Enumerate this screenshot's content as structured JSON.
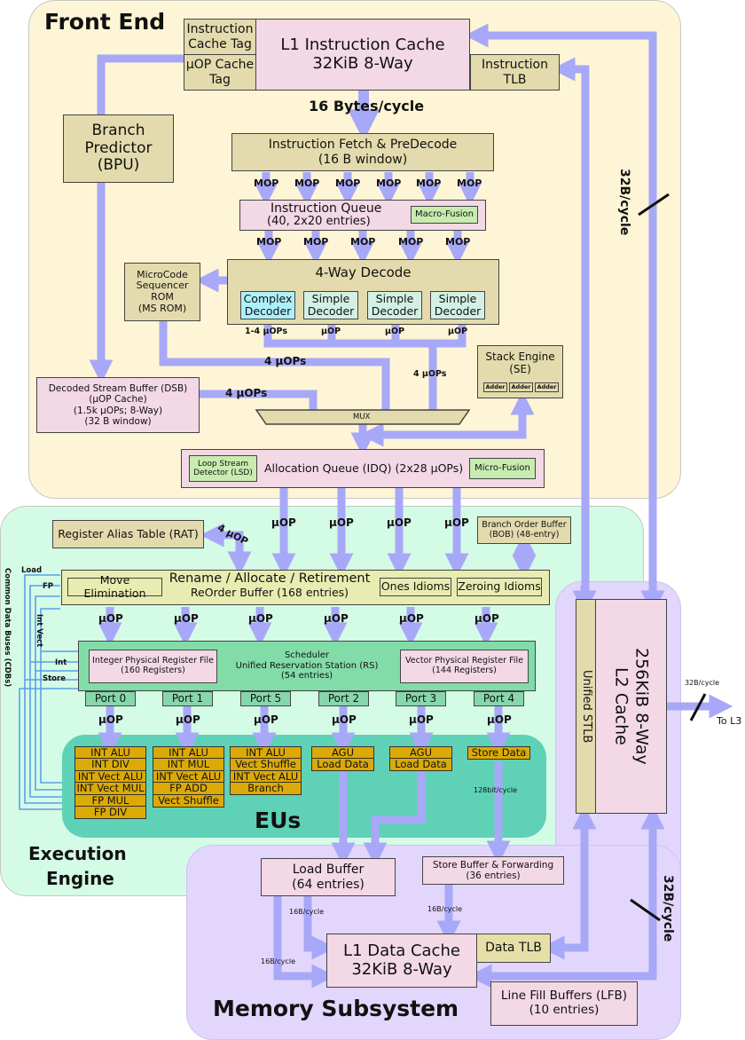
{
  "sections": {
    "front_end": "Front End",
    "execution_engine_line1": "Execution",
    "execution_engine_line2": "Engine",
    "eus": "EUs",
    "memory_subsystem": "Memory Subsystem"
  },
  "front_end": {
    "icache_tag": "Instruction Cache Tag",
    "uop_cache_tag": "µOP Cache Tag",
    "l1i_line1": "L1 Instruction Cache",
    "l1i_line2": "32KiB 8-Way",
    "itlb": "Instruction TLB",
    "fetch_bw": "16 Bytes/cycle",
    "bpu_line1": "Branch",
    "bpu_line2": "Predictor",
    "bpu_line3": "(BPU)",
    "fetch_line1": "Instruction Fetch & PreDecode",
    "fetch_line2": "(16 B window)",
    "mop": "MOP",
    "iq_line1": "Instruction Queue",
    "iq_line2": "(40, 2x20 entries)",
    "macro_fusion": "Macro-Fusion",
    "msrom_line1": "MicroCode",
    "msrom_line2": "Sequencer",
    "msrom_line3": "ROM",
    "msrom_line4": "(MS ROM)",
    "decode_title": "4-Way Decode",
    "decoders": [
      {
        "line1": "Complex",
        "line2": "Decoder"
      },
      {
        "line1": "Simple",
        "line2": "Decoder"
      },
      {
        "line1": "Simple",
        "line2": "Decoder"
      },
      {
        "line1": "Simple",
        "line2": "Decoder"
      }
    ],
    "decoder_outputs": [
      "1-4 µOPs",
      "µOP",
      "µOP",
      "µOP"
    ],
    "four_uops": "4 µOPs",
    "dsb_line1": "Decoded Stream Buffer (DSB)",
    "dsb_line2": "(µOP Cache)",
    "dsb_line3": "(1.5k µOPs; 8-Way)",
    "dsb_line4": "(32 B window)",
    "stack_engine_line1": "Stack Engine",
    "stack_engine_line2": "(SE)",
    "adder": "Adder",
    "mux": "MUX",
    "lsd_line1": "Loop Stream",
    "lsd_line2": "Detector (LSD)",
    "idq": "Allocation Queue (IDQ) (2x28 µOPs)",
    "micro_fusion": "Micro-Fusion",
    "l2_link_bw": "32B/cycle"
  },
  "execution": {
    "uop": "µOP",
    "rat": "Register Alias Table (RAT)",
    "rat_link": "4 µOP",
    "bob_line1": "Branch Order Buffer",
    "bob_line2": "(BOB) (48-entry)",
    "move_elim": "Move Elimination",
    "rob_line1": "Rename / Allocate / Retirement",
    "rob_line2": "ReOrder Buffer (168 entries)",
    "ones_idioms": "Ones Idioms",
    "zeroing_idioms": "Zeroing Idioms",
    "int_prf_line1": "Integer Physical Register File",
    "int_prf_line2": "(160 Registers)",
    "sched_line1": "Scheduler",
    "sched_line2": "Unified Reservation Station (RS)",
    "sched_line3": "(54 entries)",
    "vec_prf_line1": "Vector Physical Register File",
    "vec_prf_line2": "(144 Registers)",
    "ports": [
      "Port 0",
      "Port 1",
      "Port 5",
      "Port 2",
      "Port 3",
      "Port 4"
    ],
    "cdb_title": "Common Data Buses (CDBs)",
    "cdb_labels": {
      "load": "Load",
      "fp": "FP",
      "int_vect": "Int Vect",
      "int": "Int",
      "store": "Store"
    },
    "eu_port0": [
      "INT ALU",
      "INT DIV",
      "INT Vect ALU",
      "INT Vect MUL",
      "FP MUL",
      "FP DIV"
    ],
    "eu_port1": [
      "INT ALU",
      "INT MUL",
      "INT Vect ALU",
      "FP ADD",
      "Vect Shuffle"
    ],
    "eu_port5": [
      "INT ALU",
      "Vect Shuffle",
      "INT Vect ALU",
      "Branch"
    ],
    "eu_port2": [
      "AGU",
      "Load Data"
    ],
    "eu_port3": [
      "AGU",
      "Load Data"
    ],
    "eu_port4": [
      "Store Data"
    ],
    "store_bw": "128bit/cycle"
  },
  "memory": {
    "load_buffer_line1": "Load Buffer",
    "load_buffer_line2": "(64 entries)",
    "store_buffer_line1": "Store Buffer & Forwarding",
    "store_buffer_line2": "(36 entries)",
    "bw16": "16B/cycle",
    "l1d_line1": "L1 Data Cache",
    "l1d_line2": "32KiB 8-Way",
    "dtlb": "Data TLB",
    "lfb_line1": "Line Fill Buffers (LFB)",
    "lfb_line2": "(10 entries)",
    "stlb": "Unified STLB",
    "l2_line1": "L2 Cache",
    "l2_line2": "256KiB 8-Way",
    "l3_bw": "32B/cycle",
    "to_l3": "To L3",
    "l2_l1d_bw": "32B/cycle"
  },
  "colors": {
    "wire": "#a8a8f8",
    "front_end_bg": "#fdf5d6",
    "execution_bg": "#d4fbe6",
    "memory_bg": "#e2d6fc",
    "eu_bg": "#dcaa06"
  }
}
